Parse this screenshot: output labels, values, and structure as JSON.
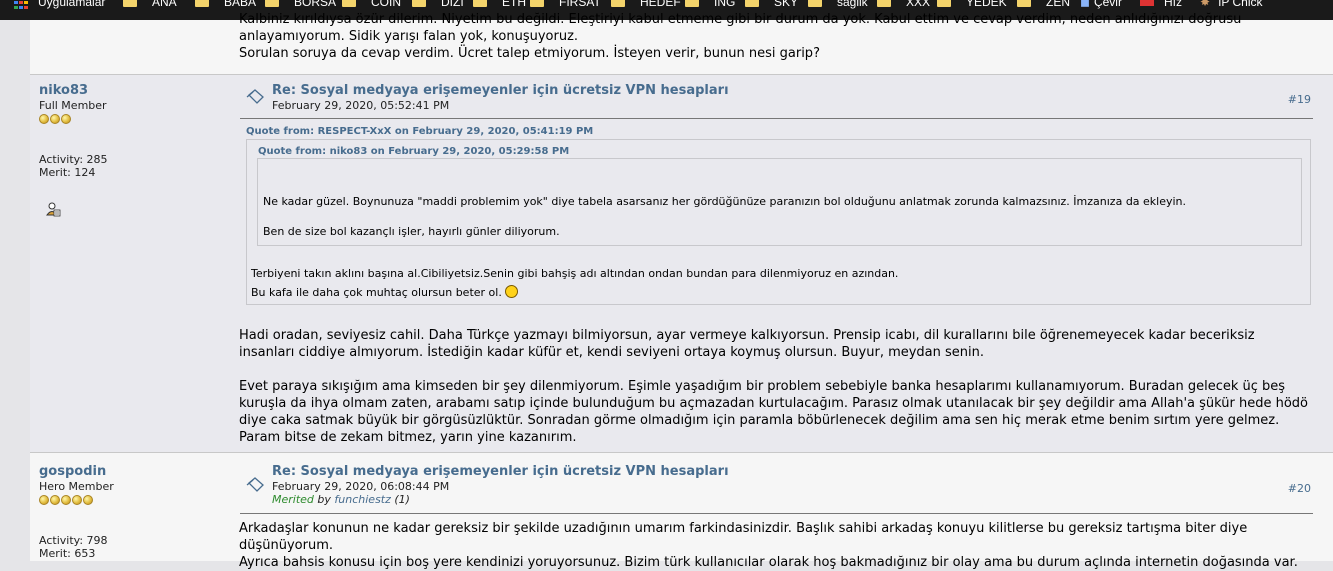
{
  "bookmarks": {
    "apps_label": "Uygulamalar",
    "items": [
      "ANA",
      "BABA",
      "BORSA",
      "COIN",
      "DIZI",
      "ETH",
      "FIRSAT",
      "HEDEF",
      "ING",
      "SKY",
      "saglik",
      "XXX",
      "YEDEK",
      "ZEN"
    ],
    "translate_label": "Çevir",
    "hiz_label": "Hız",
    "ipcheck_label": "IP Chick"
  },
  "post1": {
    "line1": "Kalbiniz kırıldıysa özür dilerim. Niyetim bu değildi. Eleştiriyi kabul etmeme gibi bir durum da yok. Kabul ettim ve cevap verdim, neden anlıdığınızı doğrusu",
    "line2": "anlayamıyorum. Sidik yarışı falan yok, konuşuyoruz.",
    "line3": "Sorulan soruya da cevap verdim. Ücret talep etmiyorum. İsteyen verir, bunun nesi garip?"
  },
  "post2": {
    "username": "niko83",
    "rank": "Full Member",
    "stars": 3,
    "activity": "Activity: 285",
    "merit": "Merit: 124",
    "subject": "Re: Sosyal medyaya erişemeyenler için ücretsiz VPN hesapları",
    "date": "February 29, 2020, 05:52:41 PM",
    "number": "#19",
    "quote_outer_header": "Quote from: RESPECT-XxX on February 29, 2020, 05:41:19 PM",
    "quote_inner_header": "Quote from: niko83 on February 29, 2020, 05:29:58 PM",
    "quote_inner_line1": "Ne kadar güzel. Boynunuza \"maddi problemim yok\" diye tabela asarsanız her gördüğünüze paranızın bol olduğunu anlatmak zorunda kalmazsınız. İmzanıza da ekleyin.",
    "quote_inner_line2": "Ben de size bol kazançlı işler, hayırlı günler diliyorum.",
    "quote_outer_line1": "Terbiyeni takın aklını başına al.Cibiliyetsiz.Senin gibi bahşiş adı altından ondan bundan para dilenmiyoruz en azından.",
    "quote_outer_line2": "Bu kafa ile daha çok muhtaç olursun beter ol.",
    "body_p1_l1": "Hadi oradan, seviyesiz cahil. Daha Türkçe yazmayı bilmiyorsun, ayar vermeye kalkıyorsun. Prensip icabı, dil kurallarını bile öğrenemeyecek kadar beceriksiz",
    "body_p1_l2": "insanları ciddiye almıyorum. İstediğin kadar küfür et, kendi seviyeni ortaya koymuş olursun. Buyur, meydan senin.",
    "body_p2_l1": "Evet paraya sıkışığım ama kimseden bir şey dilenmiyorum. Eşimle yaşadığım bir problem sebebiyle banka hesaplarımı kullanamıyorum. Buradan gelecek üç beş",
    "body_p2_l2": "kuruşla da ihya olmam zaten, arabamı satıp içinde bulunduğum bu açmazadan kurtulacağım. Parasız olmak utanılacak bir şey değildir ama Allah'a şükür hede hödö",
    "body_p2_l3": "diye caka satmak büyük bir görgüsüzlüktür. Sonradan görme olmadığım için paramla böbürlenecek değilim ama sen hiç merak etme benim sırtım yere gelmez.",
    "body_p2_l4": "Param bitse de zekam bitmez, yarın yine kazanırım."
  },
  "post3": {
    "username": "gospodin",
    "rank": "Hero Member",
    "stars": 5,
    "activity": "Activity: 798",
    "merit": "Merit: 653",
    "subject": "Re: Sosyal medyaya erişemeyenler için ücretsiz VPN hesapları",
    "date": "February 29, 2020, 06:08:44 PM",
    "merited_label": "Merited",
    "merited_by": "by",
    "merited_user": "funchiestz",
    "merited_count": "(1)",
    "number": "#20",
    "body_l1": "Arkadaşlar konunun ne kadar gereksiz bir şekilde uzadığının umarım farkindasinizdir. Başlık sahibi arkadaş konuyu kilitlerse bu gereksiz tartışma biter diye",
    "body_l2": "düşünüyorum.",
    "body_l3": "Ayrıca bahsis konusu için boş yere kendinizi yoruyorsunuz. Bizim türk kullanıcılar olarak hoş bakmadığınız bir olay ama bu durum açlında internetin doğasında var."
  },
  "colors": {
    "link": "#476c8e",
    "merited_green": "#2e8b2e",
    "bookmark_bar": "#1a1a1a"
  }
}
